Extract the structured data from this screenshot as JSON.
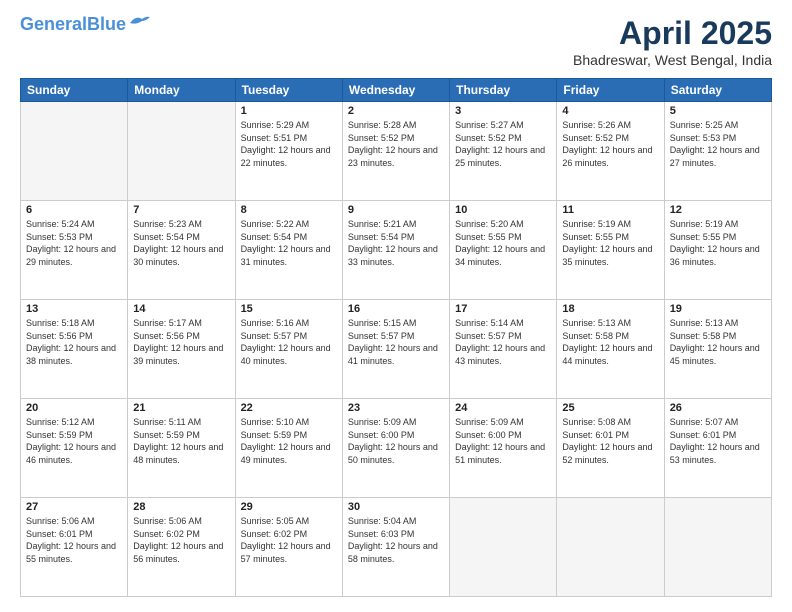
{
  "header": {
    "logo_line1": "General",
    "logo_line2": "Blue",
    "title": "April 2025",
    "location": "Bhadreswar, West Bengal, India"
  },
  "days_of_week": [
    "Sunday",
    "Monday",
    "Tuesday",
    "Wednesday",
    "Thursday",
    "Friday",
    "Saturday"
  ],
  "weeks": [
    [
      {
        "day": "",
        "empty": true
      },
      {
        "day": "",
        "empty": true
      },
      {
        "day": "1",
        "sunrise": "5:29 AM",
        "sunset": "5:51 PM",
        "daylight": "12 hours and 22 minutes."
      },
      {
        "day": "2",
        "sunrise": "5:28 AM",
        "sunset": "5:52 PM",
        "daylight": "12 hours and 23 minutes."
      },
      {
        "day": "3",
        "sunrise": "5:27 AM",
        "sunset": "5:52 PM",
        "daylight": "12 hours and 25 minutes."
      },
      {
        "day": "4",
        "sunrise": "5:26 AM",
        "sunset": "5:52 PM",
        "daylight": "12 hours and 26 minutes."
      },
      {
        "day": "5",
        "sunrise": "5:25 AM",
        "sunset": "5:53 PM",
        "daylight": "12 hours and 27 minutes."
      }
    ],
    [
      {
        "day": "6",
        "sunrise": "5:24 AM",
        "sunset": "5:53 PM",
        "daylight": "12 hours and 29 minutes."
      },
      {
        "day": "7",
        "sunrise": "5:23 AM",
        "sunset": "5:54 PM",
        "daylight": "12 hours and 30 minutes."
      },
      {
        "day": "8",
        "sunrise": "5:22 AM",
        "sunset": "5:54 PM",
        "daylight": "12 hours and 31 minutes."
      },
      {
        "day": "9",
        "sunrise": "5:21 AM",
        "sunset": "5:54 PM",
        "daylight": "12 hours and 33 minutes."
      },
      {
        "day": "10",
        "sunrise": "5:20 AM",
        "sunset": "5:55 PM",
        "daylight": "12 hours and 34 minutes."
      },
      {
        "day": "11",
        "sunrise": "5:19 AM",
        "sunset": "5:55 PM",
        "daylight": "12 hours and 35 minutes."
      },
      {
        "day": "12",
        "sunrise": "5:19 AM",
        "sunset": "5:55 PM",
        "daylight": "12 hours and 36 minutes."
      }
    ],
    [
      {
        "day": "13",
        "sunrise": "5:18 AM",
        "sunset": "5:56 PM",
        "daylight": "12 hours and 38 minutes."
      },
      {
        "day": "14",
        "sunrise": "5:17 AM",
        "sunset": "5:56 PM",
        "daylight": "12 hours and 39 minutes."
      },
      {
        "day": "15",
        "sunrise": "5:16 AM",
        "sunset": "5:57 PM",
        "daylight": "12 hours and 40 minutes."
      },
      {
        "day": "16",
        "sunrise": "5:15 AM",
        "sunset": "5:57 PM",
        "daylight": "12 hours and 41 minutes."
      },
      {
        "day": "17",
        "sunrise": "5:14 AM",
        "sunset": "5:57 PM",
        "daylight": "12 hours and 43 minutes."
      },
      {
        "day": "18",
        "sunrise": "5:13 AM",
        "sunset": "5:58 PM",
        "daylight": "12 hours and 44 minutes."
      },
      {
        "day": "19",
        "sunrise": "5:13 AM",
        "sunset": "5:58 PM",
        "daylight": "12 hours and 45 minutes."
      }
    ],
    [
      {
        "day": "20",
        "sunrise": "5:12 AM",
        "sunset": "5:59 PM",
        "daylight": "12 hours and 46 minutes."
      },
      {
        "day": "21",
        "sunrise": "5:11 AM",
        "sunset": "5:59 PM",
        "daylight": "12 hours and 48 minutes."
      },
      {
        "day": "22",
        "sunrise": "5:10 AM",
        "sunset": "5:59 PM",
        "daylight": "12 hours and 49 minutes."
      },
      {
        "day": "23",
        "sunrise": "5:09 AM",
        "sunset": "6:00 PM",
        "daylight": "12 hours and 50 minutes."
      },
      {
        "day": "24",
        "sunrise": "5:09 AM",
        "sunset": "6:00 PM",
        "daylight": "12 hours and 51 minutes."
      },
      {
        "day": "25",
        "sunrise": "5:08 AM",
        "sunset": "6:01 PM",
        "daylight": "12 hours and 52 minutes."
      },
      {
        "day": "26",
        "sunrise": "5:07 AM",
        "sunset": "6:01 PM",
        "daylight": "12 hours and 53 minutes."
      }
    ],
    [
      {
        "day": "27",
        "sunrise": "5:06 AM",
        "sunset": "6:01 PM",
        "daylight": "12 hours and 55 minutes."
      },
      {
        "day": "28",
        "sunrise": "5:06 AM",
        "sunset": "6:02 PM",
        "daylight": "12 hours and 56 minutes."
      },
      {
        "day": "29",
        "sunrise": "5:05 AM",
        "sunset": "6:02 PM",
        "daylight": "12 hours and 57 minutes."
      },
      {
        "day": "30",
        "sunrise": "5:04 AM",
        "sunset": "6:03 PM",
        "daylight": "12 hours and 58 minutes."
      },
      {
        "day": "",
        "empty": true
      },
      {
        "day": "",
        "empty": true
      },
      {
        "day": "",
        "empty": true
      }
    ]
  ],
  "labels": {
    "sunrise_prefix": "Sunrise: ",
    "sunset_prefix": "Sunset: ",
    "daylight_prefix": "Daylight: "
  }
}
